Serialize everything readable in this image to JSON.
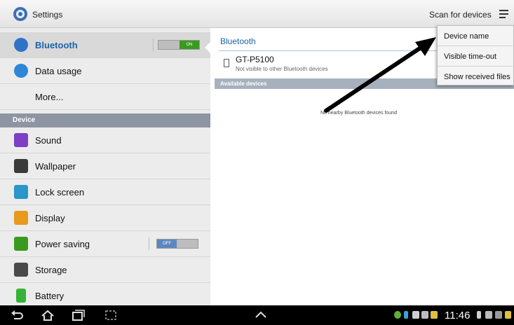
{
  "action_bar": {
    "title": "Settings",
    "scan_label": "Scan for devices"
  },
  "sidebar": {
    "items": [
      {
        "label": "Bluetooth",
        "toggle": "ON",
        "icon": "bluetooth-icon"
      },
      {
        "label": "Data usage",
        "icon": "data-usage-icon"
      },
      {
        "label": "More...",
        "icon": ""
      }
    ],
    "device_header": "Device",
    "device_items": [
      {
        "label": "Sound",
        "icon": "sound-icon"
      },
      {
        "label": "Wallpaper",
        "icon": "wallpaper-icon"
      },
      {
        "label": "Lock screen",
        "icon": "lock-icon"
      },
      {
        "label": "Display",
        "icon": "display-icon"
      },
      {
        "label": "Power saving",
        "toggle": "OFF",
        "icon": "power-saving-icon"
      },
      {
        "label": "Storage",
        "icon": "storage-icon"
      },
      {
        "label": "Battery",
        "icon": "battery-icon"
      }
    ]
  },
  "detail": {
    "title": "Bluetooth",
    "device_name": "GT-P5100",
    "device_status": "Not visible to other Bluetooth devices",
    "available_header": "Available devices",
    "empty_message": "No nearby Bluetooth devices found"
  },
  "menu": {
    "items": [
      "Device name",
      "Visible time-out",
      "Show received files"
    ]
  },
  "system_bar": {
    "time": "11:46"
  },
  "colors": {
    "accent": "#1a64a8",
    "toggle_on": "#3a9a1f",
    "toggle_off": "#5b87c0",
    "section_header": "#8d95a2"
  }
}
